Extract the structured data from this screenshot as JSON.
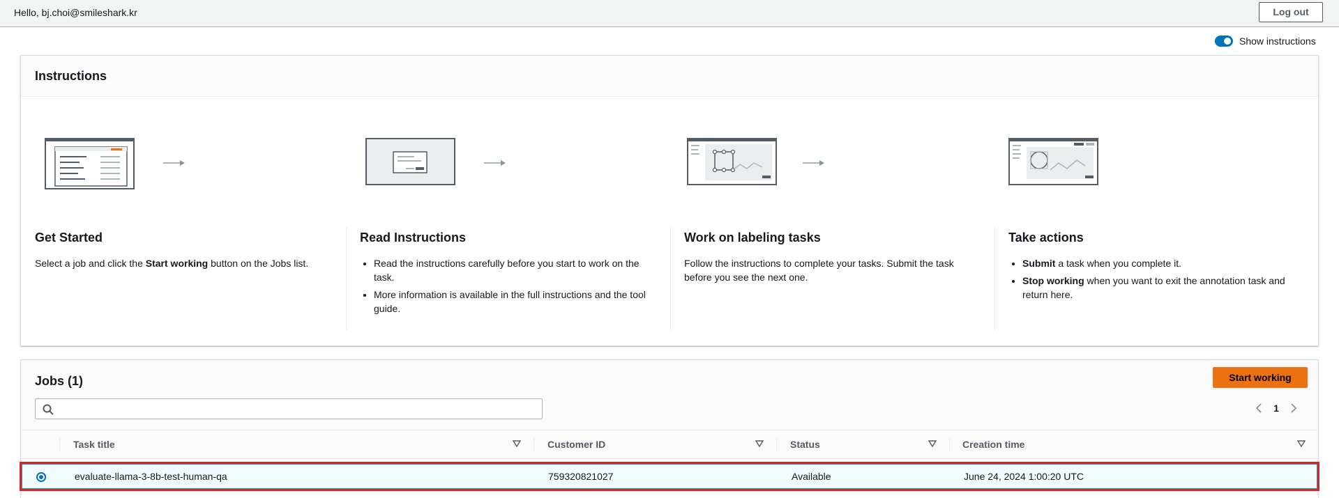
{
  "topbar": {
    "greeting": "Hello, bj.choi@smileshark.kr",
    "logout_label": "Log out"
  },
  "toggle": {
    "label": "Show instructions",
    "on": true
  },
  "instructions": {
    "title": "Instructions",
    "steps": [
      {
        "title": "Get Started",
        "desc_parts": [
          "Select a job and click the ",
          "Start working",
          " button on the Jobs list."
        ]
      },
      {
        "title": "Read Instructions",
        "bullets": [
          "Read the instructions carefully before you start to work on the task.",
          "More information is available in the full instructions and the tool guide."
        ]
      },
      {
        "title": "Work on labeling tasks",
        "desc": "Follow the instructions to complete your tasks. Submit the task before you see the next one."
      },
      {
        "title": "Take actions",
        "bullets": [
          {
            "bold": "Submit",
            "rest": " a task when you complete it."
          },
          {
            "bold": "Stop working",
            "rest": " when you want to exit the annotation task and return here."
          }
        ]
      }
    ]
  },
  "jobs": {
    "title": "Jobs (1)",
    "start_label": "Start working",
    "search_placeholder": "",
    "page": "1",
    "columns": [
      "Task title",
      "Customer ID",
      "Status",
      "Creation time"
    ],
    "rows": [
      {
        "task_title": "evaluate-llama-3-8b-test-human-qa",
        "customer_id": "759320821027",
        "status": "Available",
        "creation_time": "June 24, 2024 1:00:20 UTC",
        "selected": true
      }
    ]
  },
  "colors": {
    "accent": "#0073bb",
    "primary_button": "#ec7211",
    "highlight_border": "#e22227",
    "selected_row_bg": "#f1faff"
  }
}
